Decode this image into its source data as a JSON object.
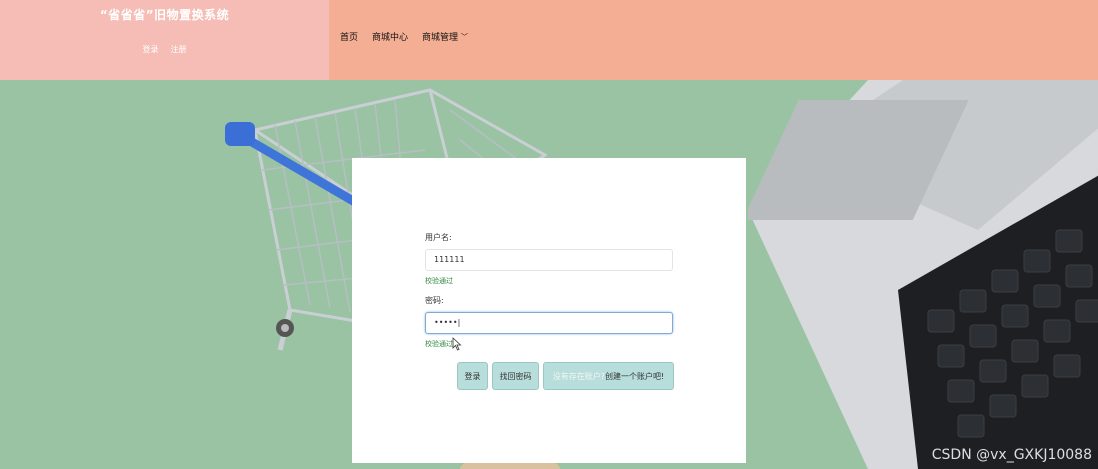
{
  "header": {
    "brand_title": "“省省省”旧物置换系统",
    "login_link": "登录",
    "register_link": "注册",
    "nav": {
      "home": "首页",
      "mall": "商城中心",
      "manage": "商城管理"
    }
  },
  "login": {
    "username_label": "用户名:",
    "username_value": "111111",
    "username_valid": "校验通过",
    "password_label": "密码:",
    "password_value": "•••••|",
    "password_valid": "校验通过",
    "buttons": {
      "login": "登录",
      "forgot": "找回密码",
      "register_prefix": "没有存在账户?",
      "register_main": "创建一个账户吧!"
    }
  },
  "watermark": "CSDN @vx_GXKJ10088",
  "colors": {
    "brand_bg": "#f5bdb5",
    "header_bg": "#f4ae93",
    "scene_bg": "#9ac3a4",
    "button_bg": "#b7dedb",
    "valid_text": "#2f8a42"
  },
  "icons": [
    "shopping-cart-image",
    "laptop-image",
    "chevron-down-icon",
    "mouse-pointer-icon"
  ]
}
